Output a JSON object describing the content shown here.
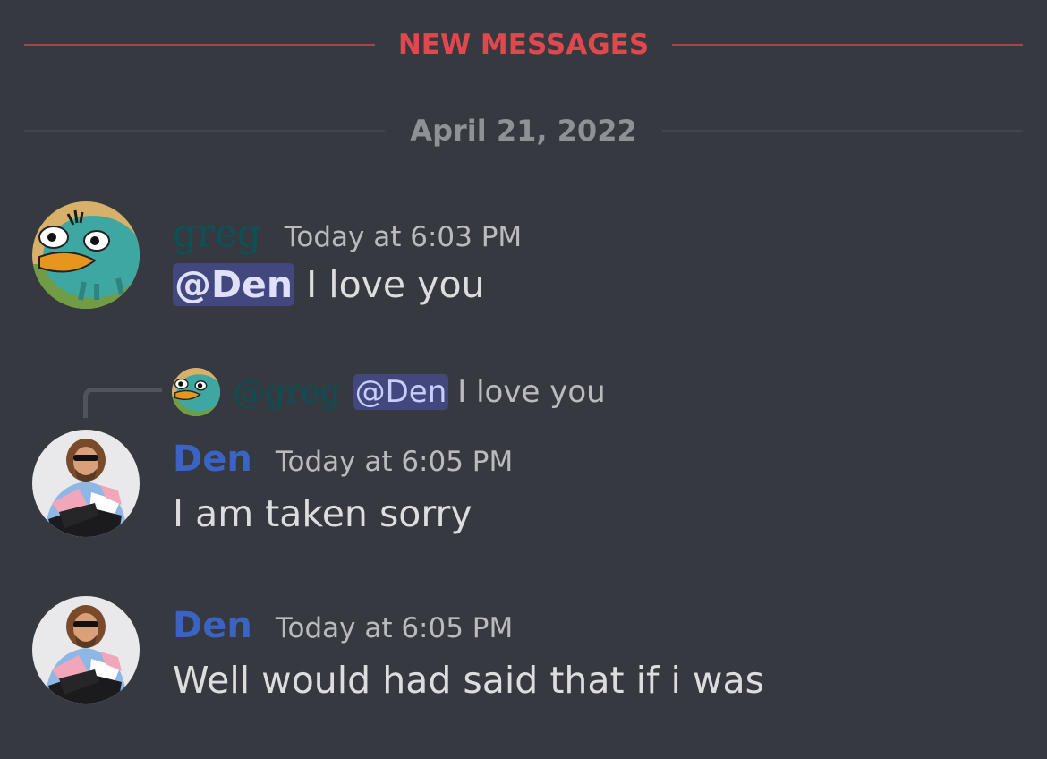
{
  "dividers": {
    "new_messages": "NEW MESSAGES",
    "date": "April 21, 2022"
  },
  "messages": [
    {
      "author": "greg",
      "timestamp": "Today at 6:03 PM",
      "mention": "@Den",
      "text": " I love you",
      "author_color": "#0b5257"
    },
    {
      "author": "Den",
      "timestamp": "Today at 6:05 PM",
      "text": "I am taken sorry",
      "author_color": "#3b63c4",
      "reply_to": {
        "author": "@greg",
        "mention": "@Den",
        "text": "I love you"
      }
    },
    {
      "author": "Den",
      "timestamp": "Today at 6:05 PM",
      "text": "Well would had said that if i was",
      "author_color": "#3b63c4"
    }
  ],
  "colors": {
    "background": "#36393f",
    "new_messages": "#e0484d",
    "mention_bg": "#4a4f8a"
  },
  "avatars": {
    "greg": "platypus-avatar",
    "den": "sunglasses-man-avatar"
  }
}
